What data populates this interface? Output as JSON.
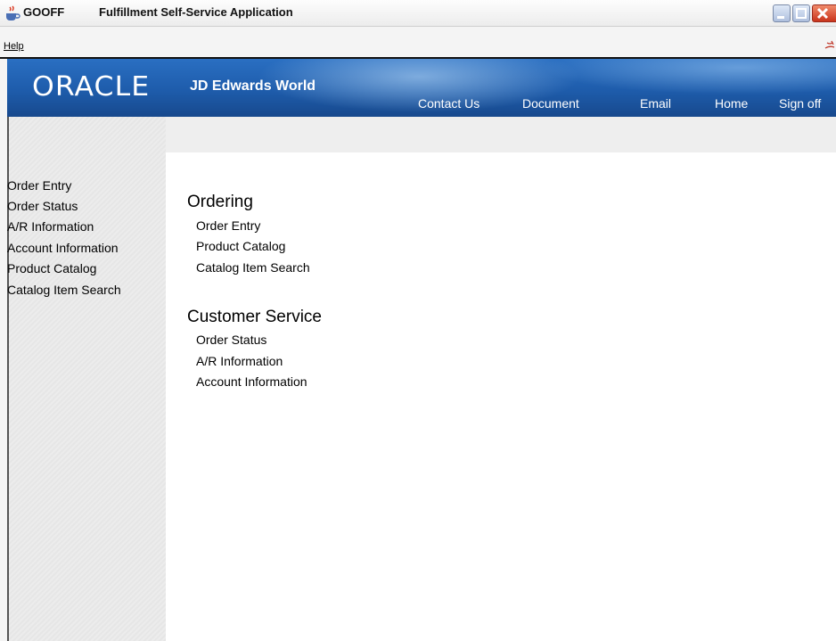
{
  "window": {
    "name": "GOOFF",
    "title": "Fulfillment Self-Service Application"
  },
  "menu": {
    "help": "Help"
  },
  "banner": {
    "logo_oracle": "ORACLE",
    "logo_product": "JD Edwards World",
    "nav": [
      "Contact Us",
      "Document",
      "Email",
      "Home",
      "Sign off"
    ]
  },
  "sidebar": {
    "items": [
      "Order Entry",
      "Order Status",
      "A/R Information",
      "Account Information",
      "Product Catalog",
      "Catalog Item Search"
    ]
  },
  "main": {
    "sections": [
      {
        "title": "Ordering",
        "links": [
          "Order Entry",
          "Product Catalog",
          "Catalog Item Search"
        ]
      },
      {
        "title": "Customer Service",
        "links": [
          "Order Status",
          "A/R Information",
          "Account Information"
        ]
      }
    ]
  },
  "colors": {
    "banner": "#1e5cab",
    "nav_text": "#ffffff"
  }
}
